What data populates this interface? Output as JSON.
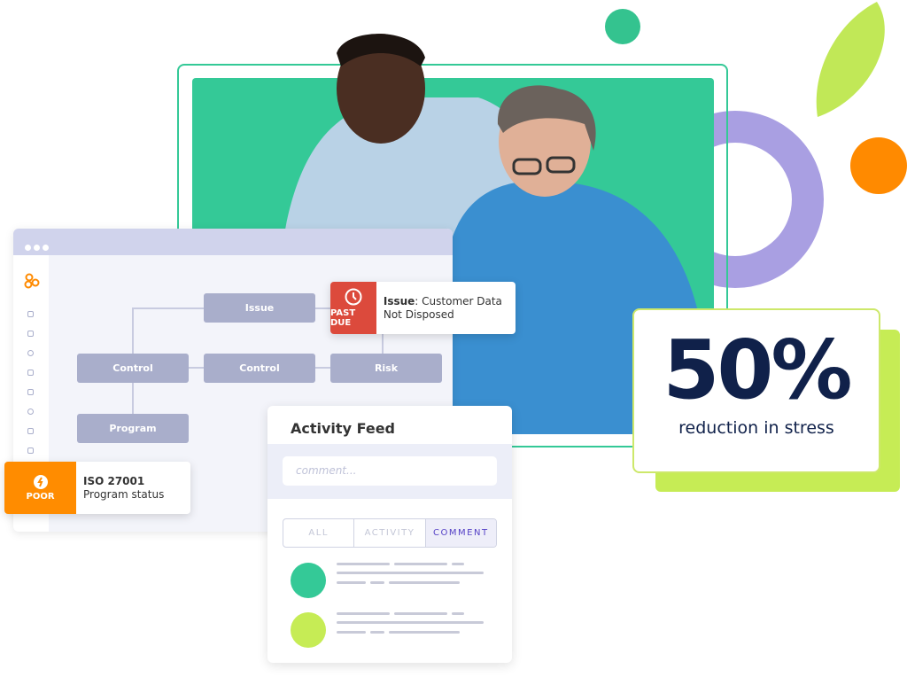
{
  "colors": {
    "green": "#34c997",
    "purple": "#a99fe2",
    "orange": "#ff8a00",
    "lime": "#c6ec55",
    "red": "#dc4a3c",
    "accent": "#5541c6"
  },
  "stat": {
    "value": "50%",
    "caption": "reduction in stress"
  },
  "app": {
    "logo": "orange-circles-logo",
    "nodes": [
      "Issue",
      "Control",
      "Control",
      "Risk",
      "Program"
    ],
    "past_due": {
      "badge": "PAST DUE",
      "icon": "clock-icon",
      "label": "Issue",
      "text": ": Customer Data Not Disposed"
    },
    "poor": {
      "badge": "POOR",
      "icon": "lightning-icon",
      "title": "ISO 27001",
      "subtitle": "Program status"
    }
  },
  "feed": {
    "title": "Activity Feed",
    "placeholder": "comment...",
    "tabs": [
      "ALL",
      "ACTIVITY",
      "COMMENT"
    ],
    "active_tab": "COMMENT",
    "avatar_colors": [
      "#34c997",
      "#c6ec55"
    ]
  }
}
